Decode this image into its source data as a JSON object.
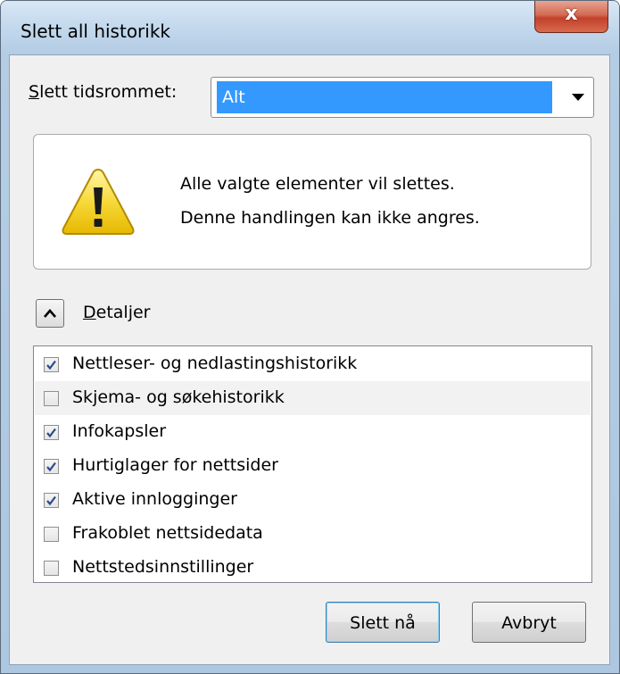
{
  "window": {
    "title": "Slett all historikk",
    "close_glyph": "x"
  },
  "range": {
    "label_accesskey": "S",
    "label_rest": "lett tidsrommet:",
    "selected": "Alt"
  },
  "warning": {
    "line1": "Alle valgte elementer vil slettes.",
    "line2": "Denne handlingen kan ikke angres."
  },
  "details": {
    "label_accesskey": "D",
    "label_rest": "etaljer",
    "expanded": true
  },
  "items": [
    {
      "label": "Nettleser- og nedlastingshistorikk",
      "checked": true
    },
    {
      "label": "Skjema- og søkehistorikk",
      "checked": false
    },
    {
      "label": "Infokapsler",
      "checked": true
    },
    {
      "label": "Hurtiglager for nettsider",
      "checked": true
    },
    {
      "label": "Aktive innlogginger",
      "checked": true
    },
    {
      "label": "Frakoblet nettsidedata",
      "checked": false
    },
    {
      "label": "Nettstedsinnstillinger",
      "checked": false
    }
  ],
  "buttons": {
    "ok": "Slett nå",
    "cancel": "Avbryt"
  },
  "icons": {
    "warning": "warning-triangle-icon",
    "collapse": "chevron-up-icon",
    "check": "checkmark-icon",
    "close": "close-icon",
    "dropdown": "chevron-down-icon"
  },
  "colors": {
    "selection": "#3399ff",
    "close_button": "#c2412a",
    "warning_yellow": "#f5d126"
  }
}
